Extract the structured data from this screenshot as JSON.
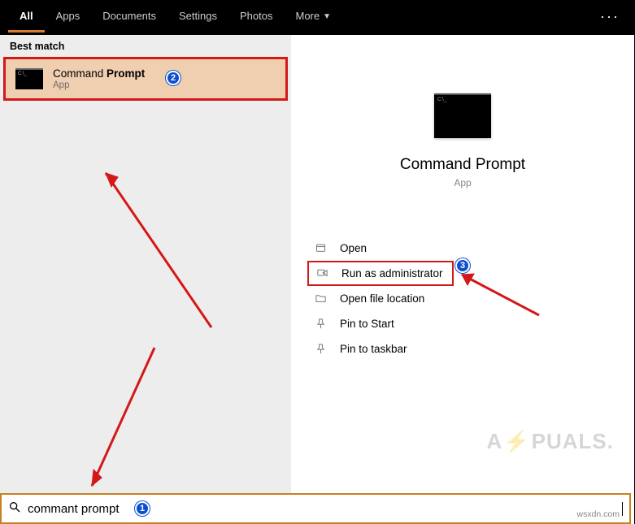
{
  "tabs": {
    "all": "All",
    "apps": "Apps",
    "documents": "Documents",
    "settings": "Settings",
    "photos": "Photos",
    "more": "More"
  },
  "sections": {
    "best_match": "Best match"
  },
  "result": {
    "title_plain": "Command ",
    "title_bold": "Prompt",
    "subtitle": "App"
  },
  "preview": {
    "title": "Command Prompt",
    "subtitle": "App"
  },
  "actions": {
    "open": "Open",
    "run_admin": "Run as administrator",
    "open_loc": "Open file location",
    "pin_start": "Pin to Start",
    "pin_taskbar": "Pin to taskbar"
  },
  "search": {
    "value": "commant prompt"
  },
  "badges": {
    "b1": "1",
    "b2": "2",
    "b3": "3"
  },
  "watermark": "wsxdn.com",
  "logo": {
    "pre": "A",
    "post": "PUALS."
  }
}
